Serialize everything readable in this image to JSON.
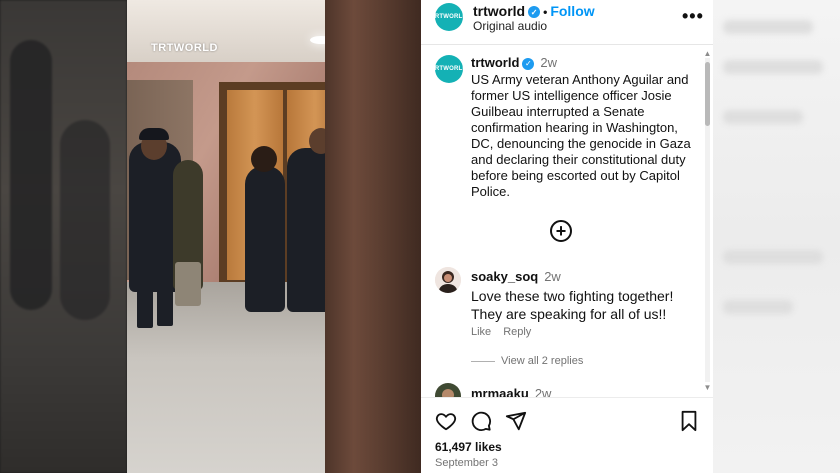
{
  "video": {
    "watermark": "TRTWORLD"
  },
  "header": {
    "avatar_text": "TRTWORLD",
    "username": "trtworld",
    "follow_label": "Follow",
    "subtitle": "Original audio",
    "more_label": "•••"
  },
  "caption": {
    "username": "trtworld",
    "time": "2w",
    "text": "US Army veteran Anthony Aguilar and former US intelligence officer Josie Guilbeau interrupted a Senate confirmation hearing in Washington, DC, denouncing the genocide in Gaza and declaring their constitutional duty before being escorted out by Capitol Police."
  },
  "comments": [
    {
      "username": "soaky_soq",
      "time": "2w",
      "text": "Love these two fighting together! They are speaking for all of us!!",
      "like_label": "Like",
      "reply_label": "Reply",
      "view_replies": "View all 2 replies"
    },
    {
      "username": "mrmaaku",
      "time": "2w"
    }
  ],
  "footer": {
    "likes": "61,497 likes",
    "date": "September 3"
  },
  "colors": {
    "accent": "#0095f6",
    "brand": "#14b1b5"
  }
}
